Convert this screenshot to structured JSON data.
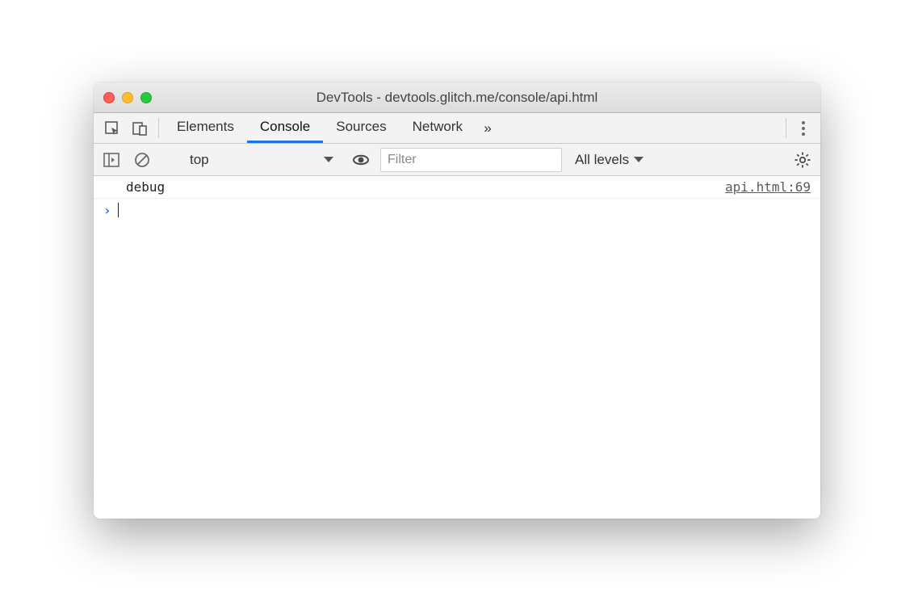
{
  "window": {
    "title": "DevTools - devtools.glitch.me/console/api.html"
  },
  "tabs": {
    "items": [
      {
        "label": "Elements",
        "active": false
      },
      {
        "label": "Console",
        "active": true
      },
      {
        "label": "Sources",
        "active": false
      },
      {
        "label": "Network",
        "active": false
      }
    ],
    "more_symbol": "»"
  },
  "toolbar": {
    "context": "top",
    "filter_placeholder": "Filter",
    "levels_label": "All levels"
  },
  "console": {
    "log": {
      "message": "debug",
      "source": "api.html:69"
    },
    "prompt": "›"
  }
}
